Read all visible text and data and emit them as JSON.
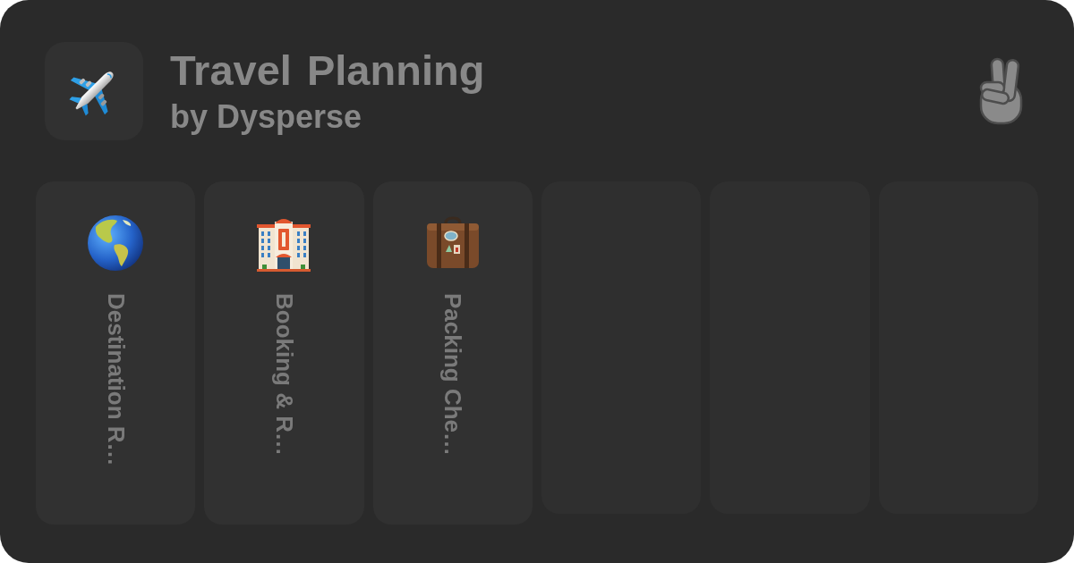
{
  "header": {
    "title": "Travel Planning",
    "subtitle": "by Dysperse"
  },
  "columns": [
    {
      "kind": "globe",
      "title": "Destination R…"
    },
    {
      "kind": "hotel",
      "title": "Booking & R…"
    },
    {
      "kind": "suitcase",
      "title": "Packing Che…"
    },
    {
      "kind": "empty"
    },
    {
      "kind": "empty"
    },
    {
      "kind": "empty"
    }
  ]
}
